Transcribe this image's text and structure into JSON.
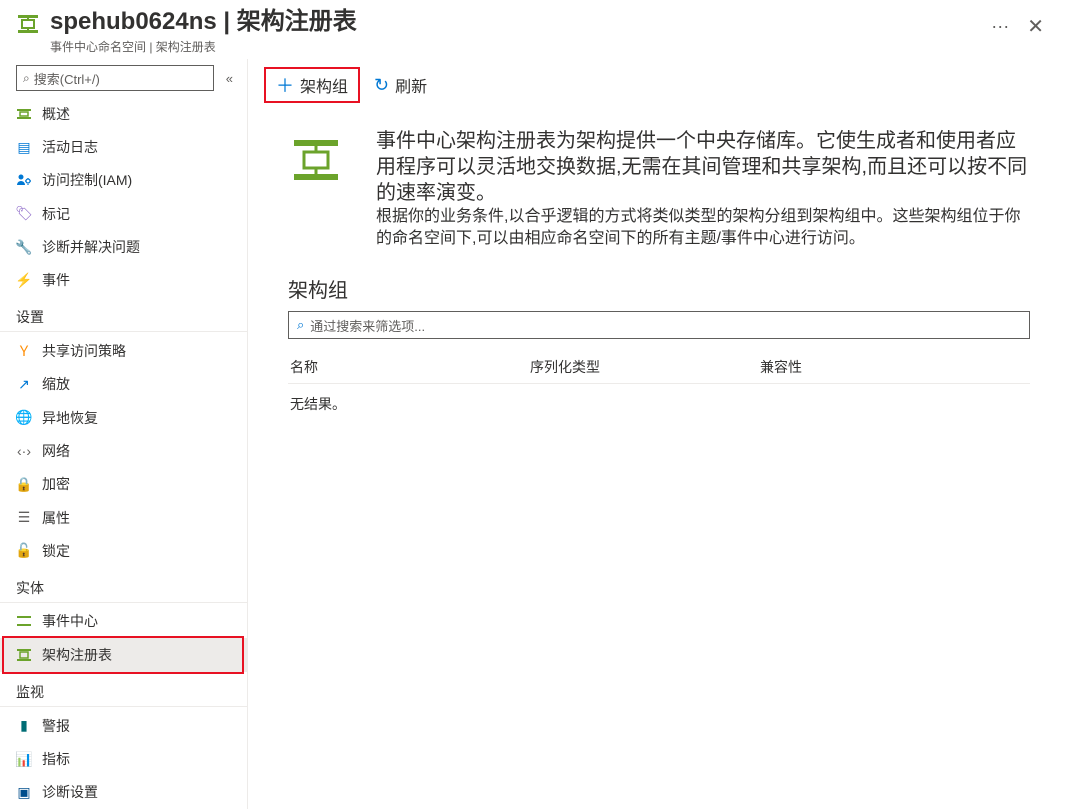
{
  "header": {
    "title": "spehub0624ns | 架构注册表",
    "subtitle": "事件中心命名空间 | 架构注册表",
    "more": "···",
    "close": "✕"
  },
  "search": {
    "placeholder": "搜索(Ctrl+/)"
  },
  "nav": {
    "top": [
      {
        "icon": "overview",
        "label": "概述"
      },
      {
        "icon": "activity",
        "label": "活动日志"
      },
      {
        "icon": "iam",
        "label": "访问控制(IAM)"
      },
      {
        "icon": "tag",
        "label": "标记"
      },
      {
        "icon": "diagnose",
        "label": "诊断并解决问题"
      },
      {
        "icon": "events",
        "label": "事件"
      }
    ],
    "settings_label": "设置",
    "settings": [
      {
        "icon": "sas",
        "label": "共享访问策略"
      },
      {
        "icon": "scale",
        "label": "缩放"
      },
      {
        "icon": "geo",
        "label": "异地恢复"
      },
      {
        "icon": "network",
        "label": "网络"
      },
      {
        "icon": "encrypt",
        "label": "加密"
      },
      {
        "icon": "props",
        "label": "属性"
      },
      {
        "icon": "lock",
        "label": "锁定"
      }
    ],
    "entities_label": "实体",
    "entities": [
      {
        "icon": "eventhub",
        "label": "事件中心"
      },
      {
        "icon": "schema",
        "label": "架构注册表"
      }
    ],
    "monitor_label": "监视",
    "monitor": [
      {
        "icon": "alerts",
        "label": "警报"
      },
      {
        "icon": "metrics",
        "label": "指标"
      },
      {
        "icon": "diag",
        "label": "诊断设置"
      }
    ]
  },
  "toolbar": {
    "add": "架构组",
    "refresh": "刷新"
  },
  "intro": {
    "line1": "事件中心架构注册表为架构提供一个中央存储库。它使生成者和使用者应用程序可以灵活地交换数据,无需在其间管理和共享架构,而且还可以按不同的速率演变。",
    "line2": "根据你的业务条件,以合乎逻辑的方式将类似类型的架构分组到架构组中。这些架构组位于你的命名空间下,可以由相应命名空间下的所有主题/事件中心进行访问。"
  },
  "section": {
    "title": "架构组",
    "filter_placeholder": "通过搜索来筛选项...",
    "col_name": "名称",
    "col_serial": "序列化类型",
    "col_compat": "兼容性",
    "no_results": "无结果。"
  }
}
